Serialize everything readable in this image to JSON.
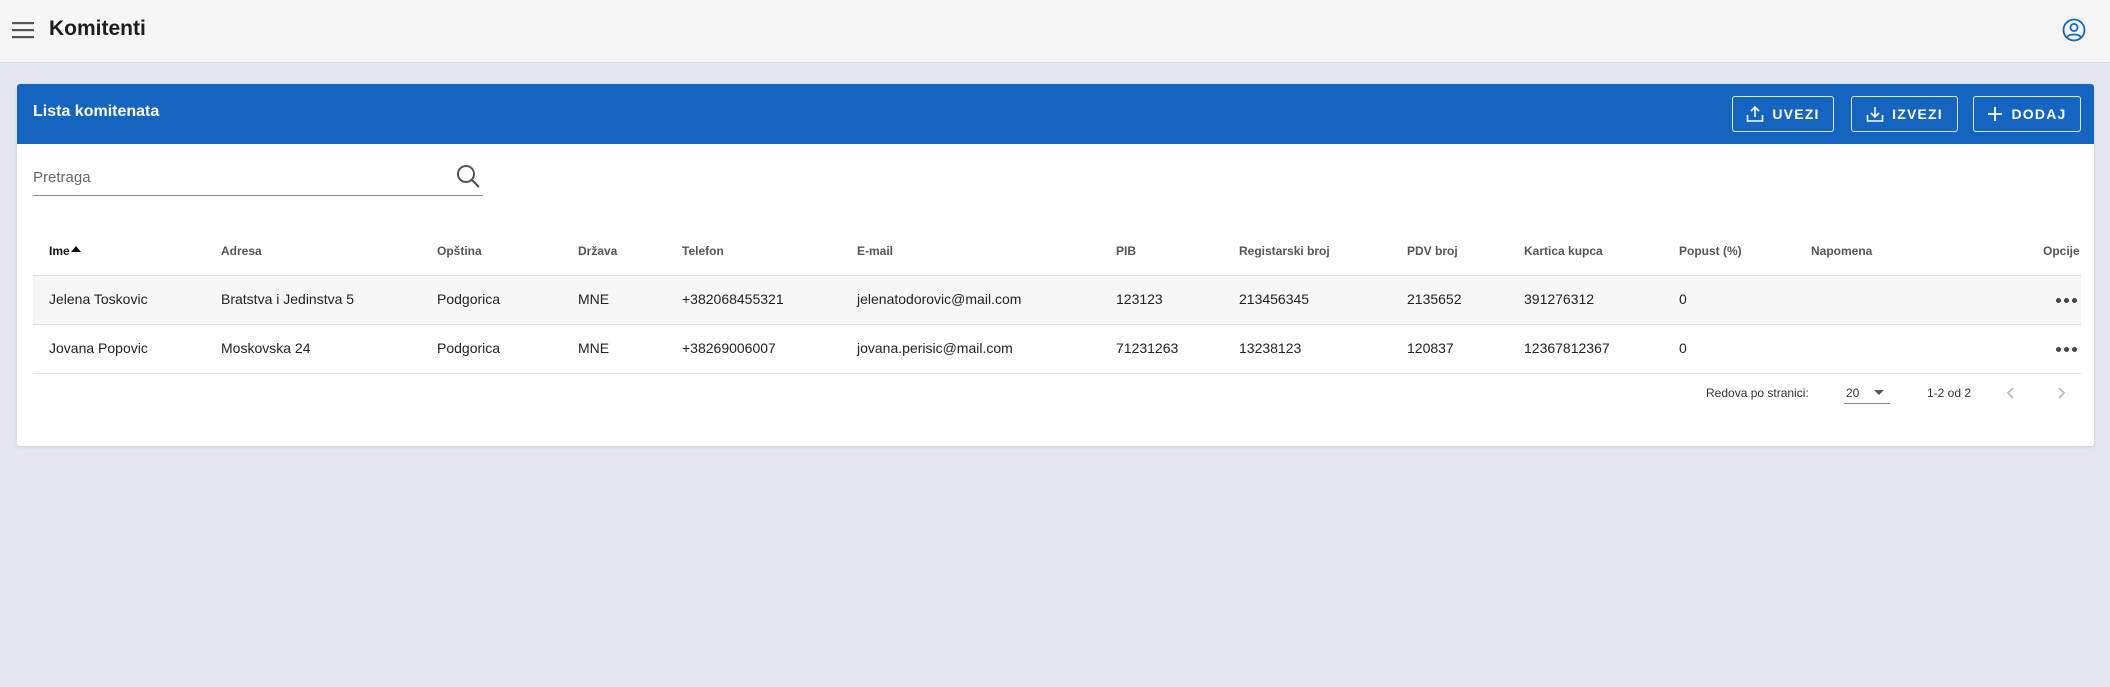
{
  "app": {
    "title": "Komitenti"
  },
  "card": {
    "title": "Lista komitenata",
    "buttons": {
      "import": "UVEZI",
      "export": "IZVEZI",
      "add": "DODAJ"
    }
  },
  "search": {
    "placeholder": "Pretraga",
    "value": ""
  },
  "table": {
    "columns": [
      "Ime",
      "Adresa",
      "Opština",
      "Država",
      "Telefon",
      "E-mail",
      "PIB",
      "Registarski broj",
      "PDV broj",
      "Kartica kupca",
      "Popust (%)",
      "Napomena",
      "Opcije"
    ],
    "sorted_column": "Ime",
    "sort_direction": "ascending",
    "rows": [
      [
        "Jelena Toskovic",
        "Bratstva i Jedinstva 5",
        "Podgorica",
        "MNE",
        "+382068455321",
        "jelenatodorovic@mail.com",
        "123123",
        "213456345",
        "2135652",
        "391276312",
        "0",
        ""
      ],
      [
        "Jovana Popovic",
        "Moskovska 24",
        "Podgorica",
        "MNE",
        "+38269006007",
        "jovana.perisic@mail.com",
        "71231263",
        "13238123",
        "120837",
        "12367812367",
        "0",
        ""
      ]
    ]
  },
  "pagination": {
    "rows_per_page_label": "Redova po stranici:",
    "rows_per_page": "20",
    "range": "1-2 od 2"
  },
  "colors": {
    "primary": "#1565c0",
    "topbar": "#f5f5f5",
    "background": "#e4e7ef"
  },
  "icons": {
    "menu": "hamburger-menu-icon",
    "user": "account-circle-icon",
    "import": "upload-icon",
    "export": "download-icon",
    "add": "plus-icon",
    "search": "search-icon",
    "options": "more-horizontal-icon"
  }
}
